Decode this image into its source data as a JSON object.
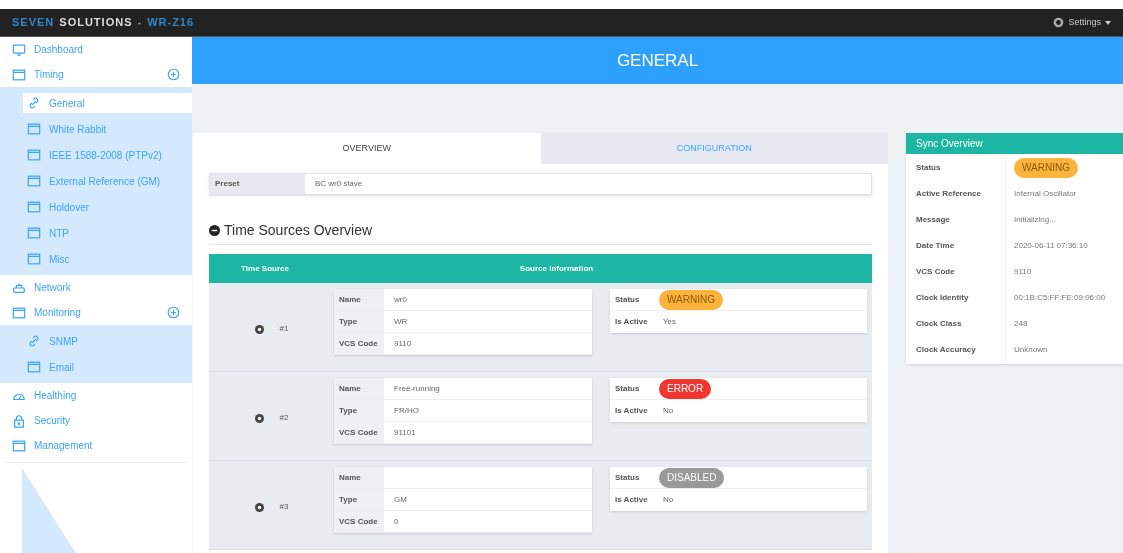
{
  "brand": {
    "part1": "SEVEN",
    "part2": "SOLUTIONS",
    "sep": "-",
    "model": "WR-Z16"
  },
  "settings": {
    "label": "Settings"
  },
  "sidebar": {
    "items": [
      {
        "label": "Dashboard"
      },
      {
        "label": "Timing",
        "expanded": true,
        "children": [
          {
            "label": "General",
            "selected": true
          },
          {
            "label": "White Rabbit",
            "selected": false
          },
          {
            "label": "IEEE 1588-2008 (PTPv2)",
            "selected": false
          },
          {
            "label": "External Reference (GM)",
            "selected": false
          },
          {
            "label": "Holdover",
            "selected": false
          },
          {
            "label": "NTP",
            "selected": false
          },
          {
            "label": "Misc",
            "selected": false
          }
        ]
      },
      {
        "label": "Network"
      },
      {
        "label": "Monitoring",
        "expanded": true,
        "children": [
          {
            "label": "SNMP",
            "selected": false
          },
          {
            "label": "Email",
            "selected": false
          }
        ]
      },
      {
        "label": "Healthing"
      },
      {
        "label": "Security"
      },
      {
        "label": "Management"
      }
    ]
  },
  "page_title": "GENERAL",
  "tabs": [
    {
      "label": "OVERVIEW",
      "selected": true
    },
    {
      "label": "CONFIGURATION",
      "selected": false
    }
  ],
  "preset": {
    "label": "Preset",
    "value": "BC wr0 slave"
  },
  "section_title": "Time Sources Overview",
  "table": {
    "columns": [
      "Time Source",
      "Source Information"
    ],
    "rows": [
      {
        "index": "#1",
        "info": [
          {
            "label": "Name",
            "value": "wr0"
          },
          {
            "label": "Type",
            "value": "WR"
          },
          {
            "label": "VCS Code",
            "value": "9110"
          }
        ],
        "status_label": "Status",
        "status": {
          "text": "WARNING",
          "kind": "warning"
        },
        "active_label": "Is Active",
        "active": "Yes"
      },
      {
        "index": "#2",
        "info": [
          {
            "label": "Name",
            "value": "Free-running"
          },
          {
            "label": "Type",
            "value": "FR/HO"
          },
          {
            "label": "VCS Code",
            "value": "91101"
          }
        ],
        "status_label": "Status",
        "status": {
          "text": "ERROR",
          "kind": "error"
        },
        "active_label": "Is Active",
        "active": "No"
      },
      {
        "index": "#3",
        "info": [
          {
            "label": "Name"
          },
          {
            "label": "Type",
            "value": "GM"
          },
          {
            "label": "VCS Code",
            "value": "0"
          }
        ],
        "status_label": "Status",
        "status": {
          "text": "DISABLED",
          "kind": "disabled"
        },
        "active_label": "Is Active",
        "active": "No"
      }
    ]
  },
  "sync_overview": {
    "title": "Sync Overview",
    "rows": [
      {
        "label": "Status",
        "value": "WARNING",
        "kind": "warning"
      },
      {
        "label": "Active Reference",
        "value": "Internal Oscillator"
      },
      {
        "label": "Message",
        "value": "Initializing..."
      },
      {
        "label": "Date Time",
        "value": "2020-06-11 07:36:10"
      },
      {
        "label": "VCS Code",
        "value": "9110"
      },
      {
        "label": "Clock Identity",
        "value": "00:1B:C5:FF:FE:09:06:00"
      },
      {
        "label": "Clock Class",
        "value": "248"
      },
      {
        "label": "Clock Accuracy",
        "value": "Unknown"
      }
    ]
  }
}
